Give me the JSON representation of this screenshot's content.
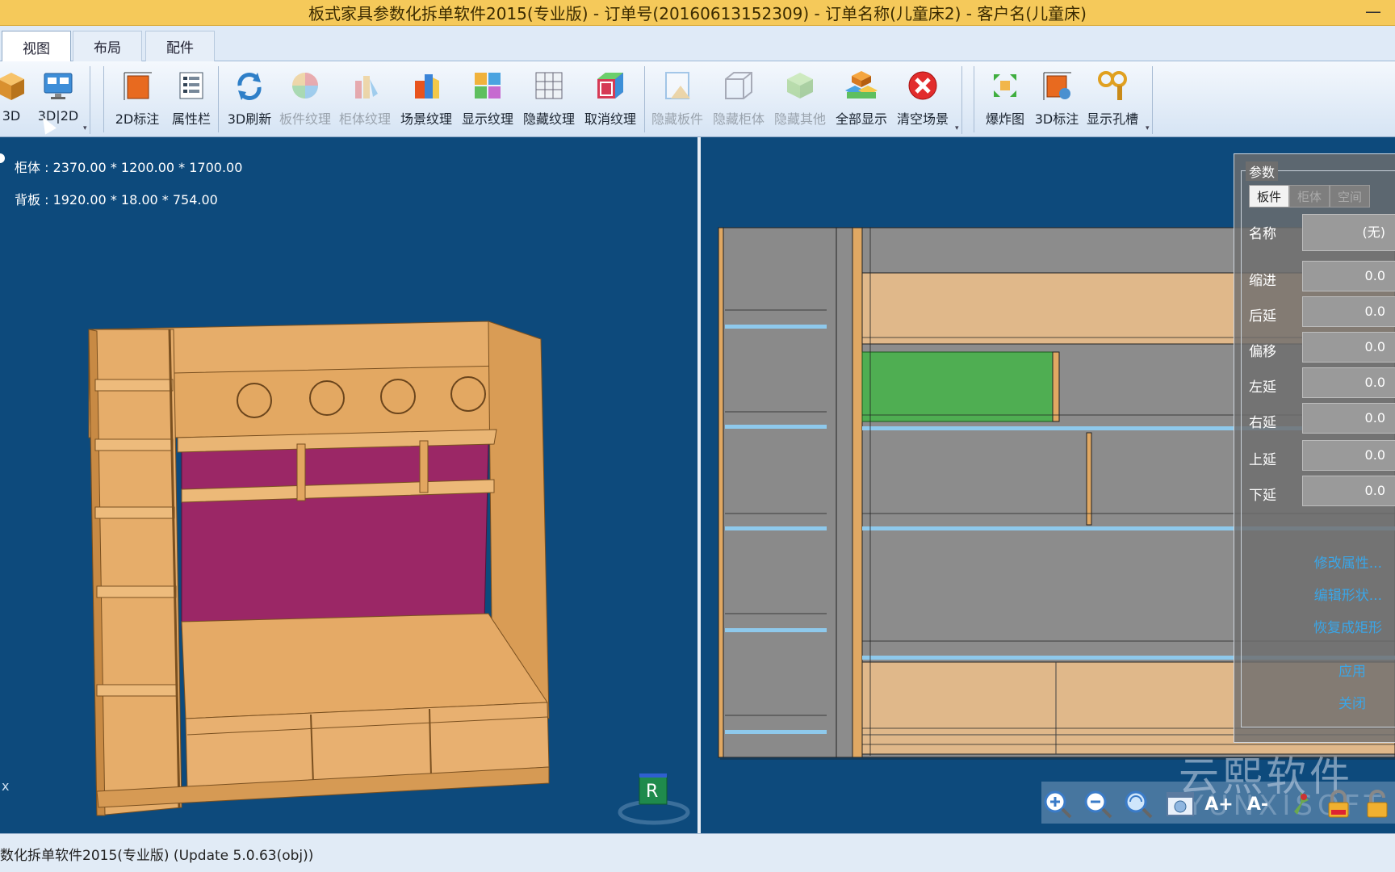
{
  "window": {
    "title": "板式家具参数化拆单软件2015(专业版) - 订单号(20160613152309) - 订单名称(儿童床2) - 客户名(儿童床)",
    "minimize_glyph": "—"
  },
  "tabs": [
    {
      "label": "视图",
      "active": true
    },
    {
      "label": "布局",
      "active": false
    },
    {
      "label": "配件",
      "active": false
    }
  ],
  "ribbon": {
    "buttons": [
      {
        "label": "3D",
        "icon": "cube-3d-icon"
      },
      {
        "label": "3D|2D",
        "icon": "split-view-icon"
      },
      {
        "label": "2D标注",
        "icon": "dimension-2d-icon"
      },
      {
        "label": "属性栏",
        "icon": "property-panel-icon"
      },
      {
        "label": "3D刷新",
        "icon": "refresh-icon"
      },
      {
        "label": "板件纹理",
        "icon": "board-texture-icon",
        "disabled": true
      },
      {
        "label": "柜体纹理",
        "icon": "cabinet-texture-icon",
        "disabled": true
      },
      {
        "label": "场景纹理",
        "icon": "scene-texture-icon"
      },
      {
        "label": "显示纹理",
        "icon": "show-texture-icon"
      },
      {
        "label": "隐藏纹理",
        "icon": "hide-texture-icon"
      },
      {
        "label": "取消纹理",
        "icon": "cancel-texture-icon"
      },
      {
        "label": "隐藏板件",
        "icon": "hide-board-icon",
        "disabled": true
      },
      {
        "label": "隐藏柜体",
        "icon": "hide-cabinet-icon",
        "disabled": true
      },
      {
        "label": "隐藏其他",
        "icon": "hide-other-icon",
        "disabled": true
      },
      {
        "label": "全部显示",
        "icon": "show-all-icon"
      },
      {
        "label": "清空场景",
        "icon": "clear-scene-icon"
      },
      {
        "label": "爆炸图",
        "icon": "explode-view-icon"
      },
      {
        "label": "3D标注",
        "icon": "dimension-3d-icon"
      },
      {
        "label": "显示孔槽",
        "icon": "show-holes-icon"
      }
    ]
  },
  "view3d": {
    "cabinet_info": "柜体 : 2370.00 * 1200.00 * 1700.00",
    "backboard_info": "背板 : 1920.00 * 18.00 * 754.00",
    "axis_label": "x",
    "gizmo_label": "R"
  },
  "params_panel": {
    "title": "参数",
    "tabs": [
      "板件",
      "柜体",
      "空间"
    ],
    "rows": [
      {
        "label": "名称",
        "value": "(无)"
      },
      {
        "label": "缩进",
        "value": "0.0"
      },
      {
        "label": "后延",
        "value": "0.0"
      },
      {
        "label": "偏移",
        "value": "0.0"
      },
      {
        "label": "左延",
        "value": "0.0"
      },
      {
        "label": "右延",
        "value": "0.0"
      },
      {
        "label": "上延",
        "value": "0.0"
      },
      {
        "label": "下延",
        "value": "0.0"
      }
    ],
    "links": [
      "修改属性...",
      "编辑形状...",
      "恢复成矩形"
    ],
    "actions": [
      "应用",
      "关闭"
    ]
  },
  "toolbar2d": {
    "buttons": [
      "zoom-in-icon",
      "zoom-out-icon",
      "zoom-fit-icon",
      "screenshot-icon",
      "font-larger-icon",
      "font-smaller-icon",
      "pin-icon",
      "lock-icon",
      "unlock-icon"
    ],
    "font_larger": "A+",
    "font_smaller": "A-"
  },
  "watermark": {
    "line1": "云熙软件",
    "line2": "YUNXISOFT"
  },
  "status": {
    "text": "数化拆单软件2015(专业版) (Update 5.0.63(obj))"
  },
  "colors": {
    "viewport_bg": "#0d4a7c",
    "wood": "#e0a863",
    "magenta_panel": "#9b2766",
    "selected_panel": "#4fae52",
    "shelf_line": "#8ec9ec",
    "link": "#3aa6e8"
  }
}
